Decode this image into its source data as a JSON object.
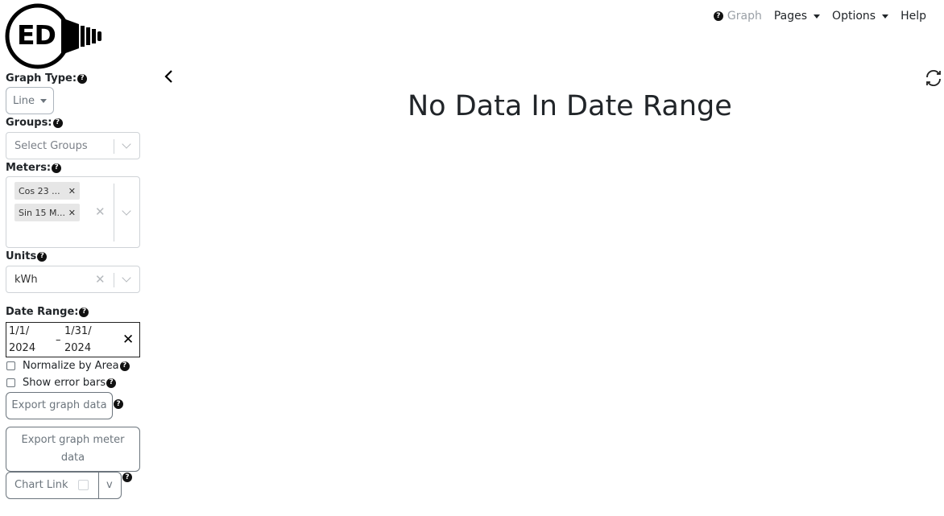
{
  "header": {
    "nav": {
      "graph": "Graph",
      "pages": "Pages",
      "options": "Options",
      "help": "Help"
    }
  },
  "logo": {
    "text": "ED"
  },
  "sidebar": {
    "graph_type": {
      "label": "Graph Type:",
      "value": "Line"
    },
    "groups": {
      "label": "Groups:",
      "placeholder": "Select Groups"
    },
    "meters": {
      "label": "Meters:",
      "selected": [
        "Cos 23 ...",
        "Sin 15 M..."
      ]
    },
    "units": {
      "label": "Units",
      "value": "kWh"
    },
    "date_range": {
      "label": "Date Range:",
      "start_line1": "1/1/",
      "start_line2": "2024",
      "separator": "–",
      "end_line1": "1/31/",
      "end_line2": "2024"
    },
    "normalize": {
      "label": "Normalize by Area",
      "checked": false
    },
    "error_bars": {
      "label": "Show error bars",
      "checked": false
    },
    "export_graph": "Export graph data",
    "export_meter": "Export graph meter data",
    "chart_link": {
      "label": "Chart Link",
      "toggle": "v"
    }
  },
  "main": {
    "message": "No Data In Date Range"
  },
  "icons": {
    "help": "question-circle-icon",
    "collapse": "chevron-left-icon",
    "refresh": "refresh-icon",
    "clear": "close-icon",
    "dropdown": "chevron-down-icon"
  }
}
